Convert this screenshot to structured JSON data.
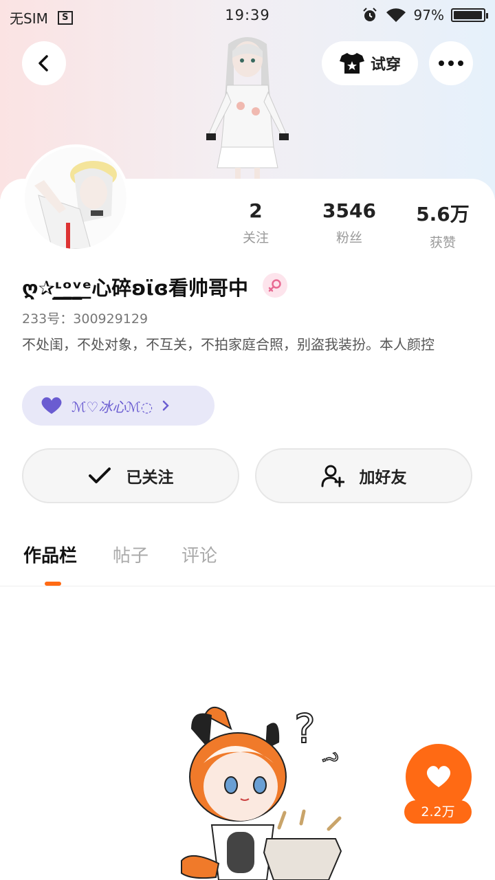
{
  "status_bar": {
    "carrier": "无SIM",
    "time": "19:39",
    "battery": "97%",
    "battery_level": 0.97
  },
  "header": {
    "back_icon": "chevron-left-icon",
    "tryon_label": "试穿",
    "tryon_icon": "tshirt-icon",
    "more_icon": "more-dots-icon"
  },
  "stats": [
    {
      "value": "2",
      "label": "关注"
    },
    {
      "value": "3546",
      "label": "粉丝"
    },
    {
      "value": "5.6万",
      "label": "获赞"
    }
  ],
  "profile": {
    "nickname": "ღ✰ᶫ̲͟ᵒ̲͟ᵛ̲͟ᵉ心碎ʚϊɞ看帅哥中",
    "gender_icon": "female-icon",
    "uid": "233号：300929129",
    "bio": "不处闺，不处对象，不互关，不拍家庭合照，别盗我装扮。本人颜控"
  },
  "medal": {
    "text": "ℳ♡冰心ℳ◌",
    "heart_color": "#6a5cd1"
  },
  "actions": {
    "follow_label": "已关注",
    "add_friend_label": "加好友"
  },
  "tabs": [
    "作品栏",
    "帖子",
    "评论"
  ],
  "like_fab": {
    "count": "2.2万"
  },
  "colors": {
    "accent": "#ff6a14",
    "female": "#e86a92"
  }
}
